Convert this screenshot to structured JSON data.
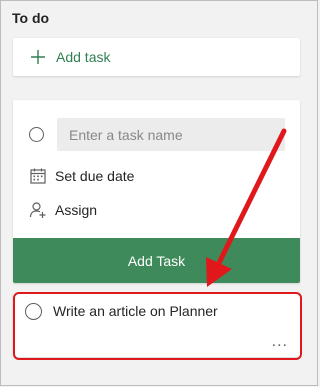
{
  "bucket": {
    "title": "To do"
  },
  "add_task_row": {
    "label": "Add task"
  },
  "new_task_form": {
    "task_name_placeholder": "Enter a task name",
    "set_due_date_label": "Set due date",
    "assign_label": "Assign",
    "submit_label": "Add Task"
  },
  "task_card": {
    "title": "Write an article on Planner",
    "more_label": "..."
  },
  "colors": {
    "accent_green": "#3f8a5a",
    "text_green": "#317f53",
    "annotation_red": "#e0181c"
  },
  "icons": {
    "add": "plus-icon",
    "calendar": "calendar-icon",
    "assign": "person-add-icon",
    "more": "more-options-icon",
    "complete": "radio-circle-icon"
  }
}
